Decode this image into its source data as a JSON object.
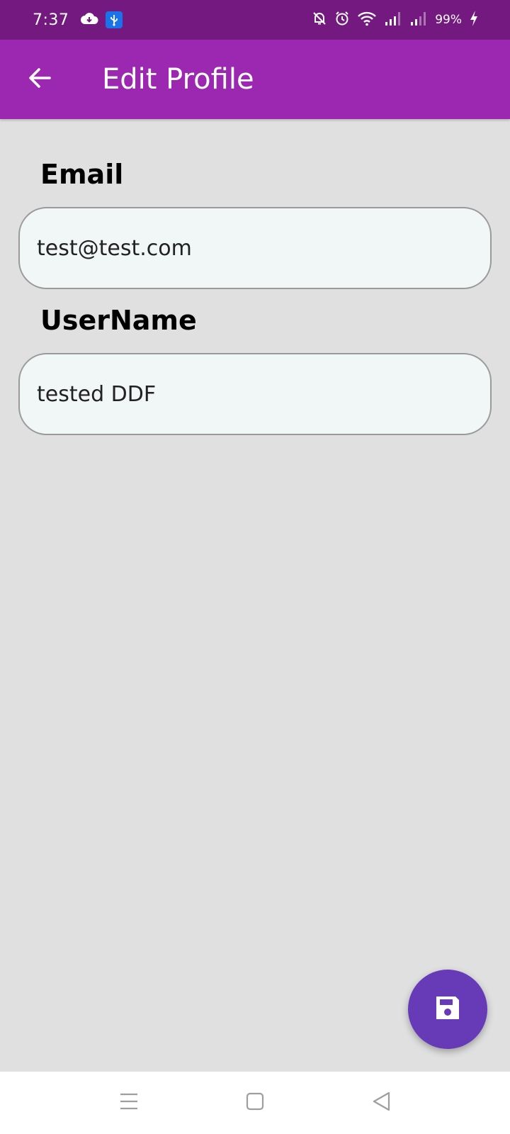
{
  "status_bar": {
    "time": "7:37",
    "battery": "99%",
    "icons": [
      "cloud-download-icon",
      "usb-icon",
      "bell-off-icon",
      "alarm-icon",
      "wifi-icon",
      "signal-1-icon",
      "signal-2-icon",
      "charging-bolt-icon"
    ]
  },
  "app_bar": {
    "title": "Edit Profile",
    "background": "#9c27b0",
    "status_background": "#74197f"
  },
  "form": {
    "email_label": "Email",
    "email_value": "test@test.com",
    "username_label": "UserName",
    "username_value": "tested DDF"
  },
  "fab": {
    "icon": "save-icon",
    "color": "#673ab7"
  },
  "nav_bar": {
    "icons": [
      "menu-icon",
      "home-icon",
      "back-triangle-icon"
    ]
  }
}
